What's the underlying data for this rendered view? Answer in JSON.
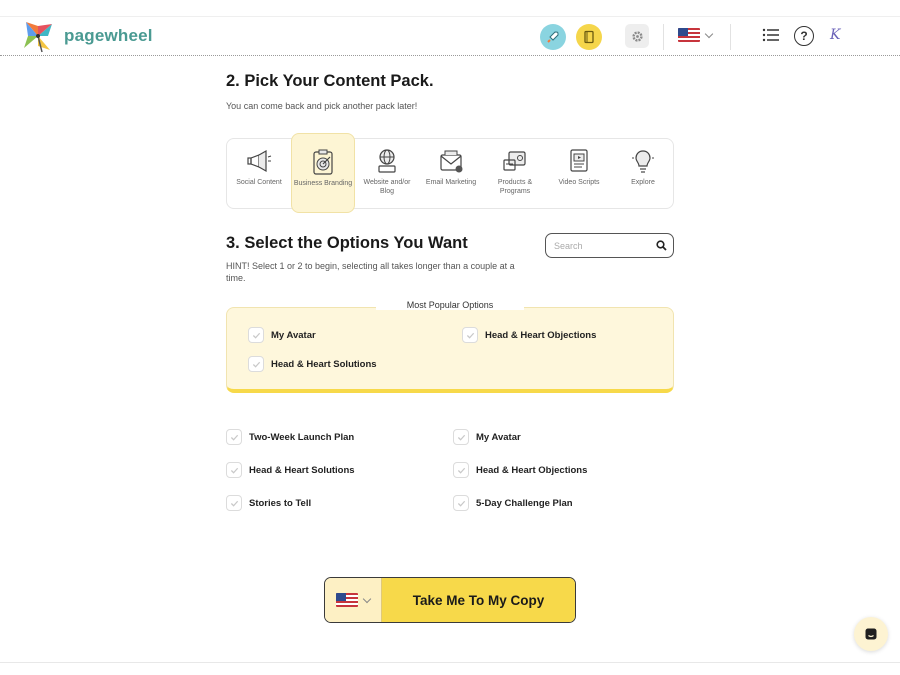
{
  "header": {
    "logo_text": "pagewheel",
    "rocket_icon": "rocket-icon",
    "book_icon": "book-icon",
    "gear_icon": "gear-icon",
    "flag_icon": "us-flag-icon",
    "list_icon": "list-icon",
    "help_label": "?",
    "user_mark": "K"
  },
  "pack_section": {
    "title": "2. Pick Your Content Pack.",
    "subtitle": "You can come back and pick another pack later!",
    "packs": [
      {
        "label": "Social Content",
        "icon": "megaphone-icon",
        "active": false
      },
      {
        "label": "Business Branding",
        "icon": "target-clipboard-icon",
        "active": true
      },
      {
        "label": "Website and/or Blog",
        "icon": "globe-person-icon",
        "active": false
      },
      {
        "label": "Email Marketing",
        "icon": "email-icon",
        "active": false
      },
      {
        "label": "Products & Programs",
        "icon": "products-icon",
        "active": false
      },
      {
        "label": "Video Scripts",
        "icon": "video-script-icon",
        "active": false
      },
      {
        "label": "Explore",
        "icon": "lightbulb-icon",
        "active": false
      }
    ]
  },
  "options_section": {
    "title": "3. Select the Options You Want",
    "hint": "HINT! Select 1 or 2 to begin, selecting all takes longer than a couple at a time.",
    "search_placeholder": "Search",
    "popular_title": "Most Popular Options",
    "popular": [
      {
        "label": "My Avatar"
      },
      {
        "label": "Head & Heart Objections"
      },
      {
        "label": "Head & Heart Solutions"
      }
    ],
    "options": [
      {
        "label": "Two-Week Launch Plan"
      },
      {
        "label": "My Avatar"
      },
      {
        "label": "Head & Heart Solutions"
      },
      {
        "label": "Head & Heart Objections"
      },
      {
        "label": "Stories to Tell"
      },
      {
        "label": "5-Day Challenge Plan"
      }
    ]
  },
  "cta": {
    "label": "Take Me To My Copy"
  },
  "colors": {
    "accent_yellow": "#f7d94a",
    "pale_yellow": "#fef7dc",
    "logo_teal": "#4a9a92"
  }
}
